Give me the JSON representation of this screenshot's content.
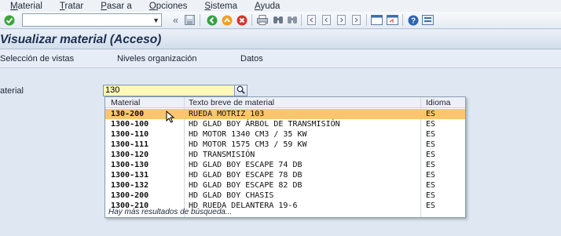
{
  "menu": {
    "items": [
      "Material",
      "Tratar",
      "Pasar a",
      "Opciones",
      "Sistema",
      "Ayuda"
    ]
  },
  "toolbar": {
    "command_field_value": "",
    "icons": [
      "enter-icon",
      "save-icon",
      "back-icon",
      "exit-icon",
      "cancel-icon",
      "print-icon",
      "find-icon",
      "find-next-icon",
      "first-page-icon",
      "previous-page-icon",
      "next-page-icon",
      "last-page-icon",
      "new-session-icon",
      "shortcut-icon",
      "help-icon",
      "customize-icon"
    ]
  },
  "title": {
    "text": "Visualizar material (Acceso)"
  },
  "app_toolbar": {
    "buttons": [
      "Selección de vistas",
      "Niveles organización",
      "Datos"
    ]
  },
  "form": {
    "material_label": "aterial",
    "material_value": "130"
  },
  "value_help": {
    "columns": [
      "Material",
      "Texto breve de material",
      "Idioma"
    ],
    "rows": [
      {
        "material": "130-200",
        "text": "RUEDA MOTRIZ 103",
        "lang": "ES",
        "selected": true
      },
      {
        "material": "1300-100",
        "text": "HD GLAD BOY ÁRBOL DE TRANSMISIÓN",
        "lang": "ES"
      },
      {
        "material": "1300-110",
        "text": "HD MOTOR 1340 CM3 / 35 KW",
        "lang": "ES"
      },
      {
        "material": "1300-111",
        "text": "HD MOTOR 1575 CM3 / 59 KW",
        "lang": "ES"
      },
      {
        "material": "1300-120",
        "text": "HD TRANSMISIÓN",
        "lang": "ES"
      },
      {
        "material": "1300-130",
        "text": "HD GLAD BOY ESCAPE 74 DB",
        "lang": "ES"
      },
      {
        "material": "1300-131",
        "text": "HD GLAD BOY ESCAPE 78 DB",
        "lang": "ES"
      },
      {
        "material": "1300-132",
        "text": "HD GLAD BOY ESCAPE 82 DB",
        "lang": "ES"
      },
      {
        "material": "1300-200",
        "text": "HD GLAD BOY CHASIS",
        "lang": "ES"
      },
      {
        "material": "1300-210",
        "text": "HD RUEDA DELANTERA 19-6",
        "lang": "ES"
      }
    ],
    "more_results": "Hay más resultados de búsqueda..."
  },
  "colors": {
    "selected_row": "#fbc66b",
    "input_bg": "#fff8b8",
    "title": "#1d2f4f"
  }
}
